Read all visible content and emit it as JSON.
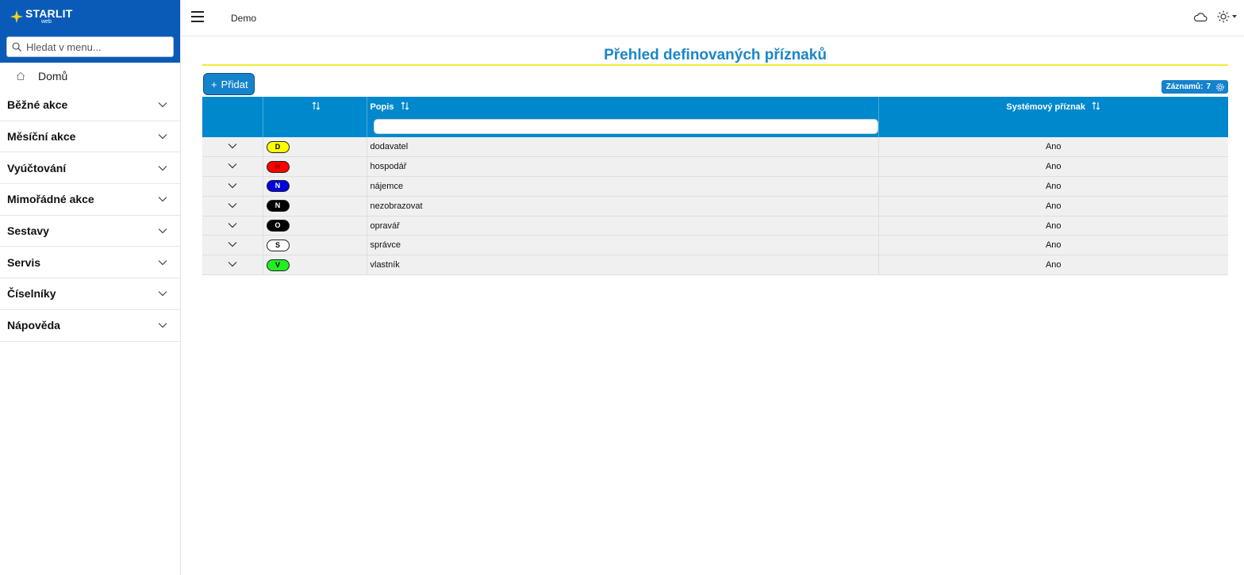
{
  "brand": {
    "name": "STARLIT",
    "sub": "web"
  },
  "sidebar": {
    "search_placeholder": "Hledat v menu...",
    "home_label": "Domů",
    "groups": [
      {
        "label": "Běžné akce"
      },
      {
        "label": "Měsíční akce"
      },
      {
        "label": "Vyúčtování"
      },
      {
        "label": "Mimořádné akce"
      },
      {
        "label": "Sestavy"
      },
      {
        "label": "Servis"
      },
      {
        "label": "Číselníky"
      },
      {
        "label": "Nápověda"
      }
    ]
  },
  "topbar": {
    "breadcrumb": "Demo"
  },
  "page": {
    "title": "Přehled definovaných příznaků",
    "add_label": "Přidat",
    "records_label": "Záznamů:",
    "records_count": "7"
  },
  "table": {
    "columns": {
      "popis": "Popis",
      "system": "Systémový příznak"
    },
    "rows": [
      {
        "code": "D",
        "popis": "dodavatel",
        "system": "Ano",
        "bg": "#ffff00",
        "fg": "#000000"
      },
      {
        "code": "H",
        "popis": "hospodář",
        "system": "Ano",
        "bg": "#ff0000",
        "fg": "#8b0000"
      },
      {
        "code": "N",
        "popis": "nájemce",
        "system": "Ano",
        "bg": "#0000dd",
        "fg": "#ffffff"
      },
      {
        "code": "N",
        "popis": "nezobrazovat",
        "system": "Ano",
        "bg": "#000000",
        "fg": "#ffffff"
      },
      {
        "code": "O",
        "popis": "opravář",
        "system": "Ano",
        "bg": "#000000",
        "fg": "#ffffff"
      },
      {
        "code": "S",
        "popis": "správce",
        "system": "Ano",
        "bg": "#ffffff",
        "fg": "#000000"
      },
      {
        "code": "V",
        "popis": "vlastník",
        "system": "Ano",
        "bg": "#22ee22",
        "fg": "#000000"
      }
    ]
  },
  "colors": {
    "brand_blue": "#0a5bb8",
    "header_blue": "#0088cc",
    "title_blue": "#1a86c8",
    "title_underline": "#f1ec38"
  }
}
